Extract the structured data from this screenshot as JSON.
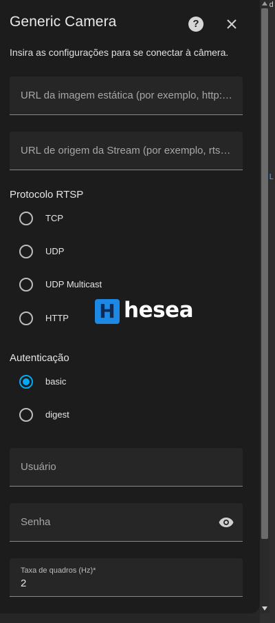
{
  "dialog": {
    "title": "Generic Camera",
    "help_icon": "help-circle-icon",
    "close_icon": "close-icon",
    "subtitle": "Insira as configurações para se conectar à câmera."
  },
  "fields": {
    "still_image_url": {
      "placeholder": "URL da imagem estática (por exemplo, http://...)"
    },
    "stream_source": {
      "placeholder": "URL de origem da Stream (por exemplo, rtsp://...."
    },
    "username": {
      "placeholder": "Usuário"
    },
    "password": {
      "placeholder": "Senha",
      "icon": "eye-icon"
    },
    "framerate": {
      "label": "Taxa de quadros (Hz)*",
      "value": "2"
    }
  },
  "rtsp_protocol": {
    "label": "Protocolo RTSP",
    "options": [
      {
        "label": "TCP",
        "checked": false
      },
      {
        "label": "UDP",
        "checked": false
      },
      {
        "label": "UDP Multicast",
        "checked": false
      },
      {
        "label": "HTTP",
        "checked": false
      }
    ]
  },
  "authentication": {
    "label": "Autenticação",
    "options": [
      {
        "label": "basic",
        "checked": true
      },
      {
        "label": "digest",
        "checked": false
      }
    ]
  },
  "watermark": {
    "badge": "H",
    "text": "hesea"
  },
  "background_peek": {
    "top": "id",
    "link": "L"
  },
  "colors": {
    "accent": "#03a9f4",
    "dialog_bg": "#1c1c1c",
    "field_bg": "#262626",
    "watermark_blue": "#1e88e5"
  }
}
